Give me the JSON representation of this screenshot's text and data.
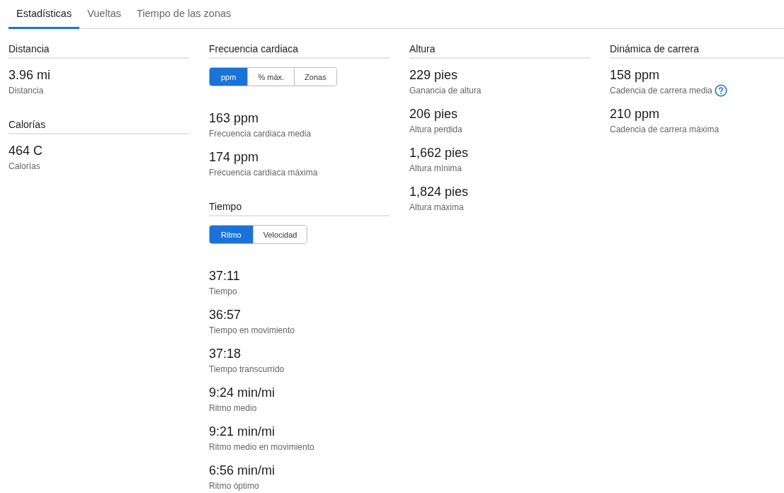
{
  "tabs": [
    {
      "label": "Estadísticas",
      "selected": true
    },
    {
      "label": "Vueltas",
      "selected": false
    },
    {
      "label": "Tiempo de las zonas",
      "selected": false
    }
  ],
  "columns": [
    {
      "sections": [
        {
          "title": "Distancia",
          "stats": [
            {
              "value": "3.96 mi",
              "label": "Distancia"
            }
          ]
        },
        {
          "title": "Calorías",
          "stats": [
            {
              "value": "464 C",
              "label": "Calorías"
            }
          ]
        }
      ]
    },
    {
      "sections": [
        {
          "title": "Frecuencia cardiaca",
          "toggle": [
            {
              "label": "ppm",
              "selected": true
            },
            {
              "label": "% máx.",
              "selected": false
            },
            {
              "label": "Zonas",
              "selected": false
            }
          ],
          "stats": [
            {
              "value": "163 ppm",
              "label": "Frecuencia cardiaca media"
            },
            {
              "value": "174 ppm",
              "label": "Frecuencia cardiaca máxima"
            }
          ]
        },
        {
          "title": "Tiempo",
          "toggle": [
            {
              "label": "Ritmo",
              "selected": true
            },
            {
              "label": "Velocidad",
              "selected": false
            }
          ],
          "stats": [
            {
              "value": "37:11",
              "label": "Tiempo"
            },
            {
              "value": "36:57",
              "label": "Tiempo en movimiento"
            },
            {
              "value": "37:18",
              "label": "Tiempo transcurrido"
            },
            {
              "value": "9:24 min/mi",
              "label": "Ritmo medio"
            },
            {
              "value": "9:21 min/mi",
              "label": "Ritmo medio en movimiento"
            },
            {
              "value": "6:56 min/mi",
              "label": "Ritmo óptimo"
            }
          ]
        }
      ]
    },
    {
      "sections": [
        {
          "title": "Altura",
          "stats": [
            {
              "value": "229 pies",
              "label": "Ganancia de altura"
            },
            {
              "value": "206 pies",
              "label": "Altura perdida"
            },
            {
              "value": "1,662 pies",
              "label": "Altura mínima"
            },
            {
              "value": "1,824 pies",
              "label": "Altura máxima"
            }
          ]
        }
      ]
    },
    {
      "sections": [
        {
          "title": "Dinámica de carrera",
          "stats": [
            {
              "value": "158 ppm",
              "label": "Cadencia de carrera media",
              "help": true
            },
            {
              "value": "210 ppm",
              "label": "Cadencia de carrera máxima"
            }
          ]
        }
      ]
    }
  ]
}
